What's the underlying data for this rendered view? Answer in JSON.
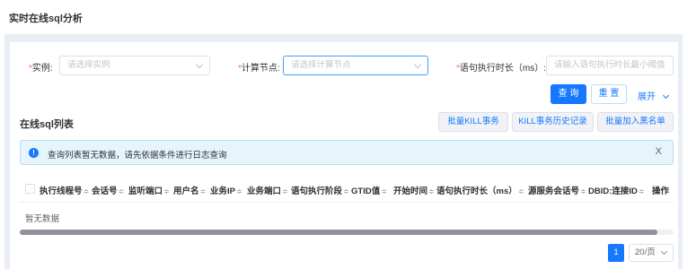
{
  "page": {
    "title": "实时在线sql分析"
  },
  "filters": {
    "instance": {
      "label": "实例:",
      "placeholder": "请选择实例"
    },
    "compute_node": {
      "label": "计算节点:",
      "placeholder": "请选择计算节点"
    },
    "duration": {
      "label": "语句执行时长（ms）:",
      "placeholder": "请输入语句执行时长最小阈值"
    },
    "required_mark": "*"
  },
  "actions": {
    "query": "查 询",
    "reset": "重 置",
    "expand": "展开",
    "expand_icon": "chevron-down-icon"
  },
  "list": {
    "title": "在线sql列表",
    "buttons": {
      "batch_kill": "批量KILL事务",
      "kill_history": "KILL事务历史记录",
      "batch_blacklist": "批量加入黑名单"
    }
  },
  "alert": {
    "icon": "info-icon",
    "text": "查询列表暂无数据，请先依据条件进行日志查询",
    "close": "X"
  },
  "table": {
    "columns": [
      "执行线程号",
      "会话号",
      "监听端口",
      "用户名",
      "业务IP",
      "业务端口",
      "语句执行阶段",
      "GTID值",
      "开始时间",
      "语句执行时长（ms）",
      "源服务会话号",
      "DBID:连接ID",
      "操作"
    ],
    "sort_glyph": "≑",
    "empty_text": "暂无数据"
  },
  "pagination": {
    "current_page": "1",
    "page_size": "20/页"
  },
  "colors": {
    "primary": "#1677ff",
    "alert_bg": "#e6f4fc",
    "required": "#f56c6c"
  }
}
